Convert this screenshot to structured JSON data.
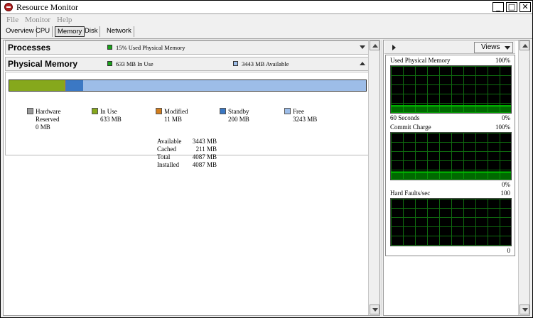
{
  "window": {
    "title": "Resource Monitor"
  },
  "menu": [
    "File",
    "Monitor",
    "Help"
  ],
  "tabs": [
    "Overview",
    "CPU",
    "Memory",
    "Disk",
    "Network"
  ],
  "active_tab": "Memory",
  "processes": {
    "title": "Processes",
    "summary": "15% Used Physical Memory",
    "swatch_color": "#1aa31a"
  },
  "physical_memory": {
    "title": "Physical Memory",
    "in_use_summary": "633 MB In Use",
    "available_summary": "3443 MB Available",
    "colors": {
      "hardware_reserved": "#9a9a9a",
      "in_use": "#86a81c",
      "modified": "#d27d1c",
      "standby": "#3b78c4",
      "free": "#9dbde8"
    },
    "bar_mb": {
      "hardware_reserved": 0,
      "in_use": 633,
      "modified": 11,
      "standby": 200,
      "free": 3243
    },
    "legend": [
      {
        "key": "hardware_reserved",
        "label": "Hardware\nReserved",
        "value": "0 MB"
      },
      {
        "key": "in_use",
        "label": "In Use",
        "value": "633 MB"
      },
      {
        "key": "modified",
        "label": "Modified",
        "value": "11 MB"
      },
      {
        "key": "standby",
        "label": "Standby",
        "value": "200 MB"
      },
      {
        "key": "free",
        "label": "Free",
        "value": "3243 MB"
      }
    ],
    "stats": [
      {
        "label": "Available",
        "value": "3443 MB"
      },
      {
        "label": "Cached",
        "value": "211 MB"
      },
      {
        "label": "Total",
        "value": "4087 MB"
      },
      {
        "label": "Installed",
        "value": "4087 MB"
      }
    ]
  },
  "right_panel": {
    "views_label": "Views",
    "graphs": [
      {
        "title": "Used Physical Memory",
        "max": "100%",
        "footer_left": "60 Seconds",
        "footer_right": "0%",
        "fill_fraction": 0.15
      },
      {
        "title": "Commit Charge",
        "max": "100%",
        "footer_left": "",
        "footer_right": "0%",
        "fill_fraction": 0.16
      },
      {
        "title": "Hard Faults/sec",
        "max": "100",
        "footer_left": "",
        "footer_right": "0",
        "fill_fraction": 0.0
      }
    ],
    "graph_color": "#00c000",
    "grid_color": "#0f6b0f"
  }
}
